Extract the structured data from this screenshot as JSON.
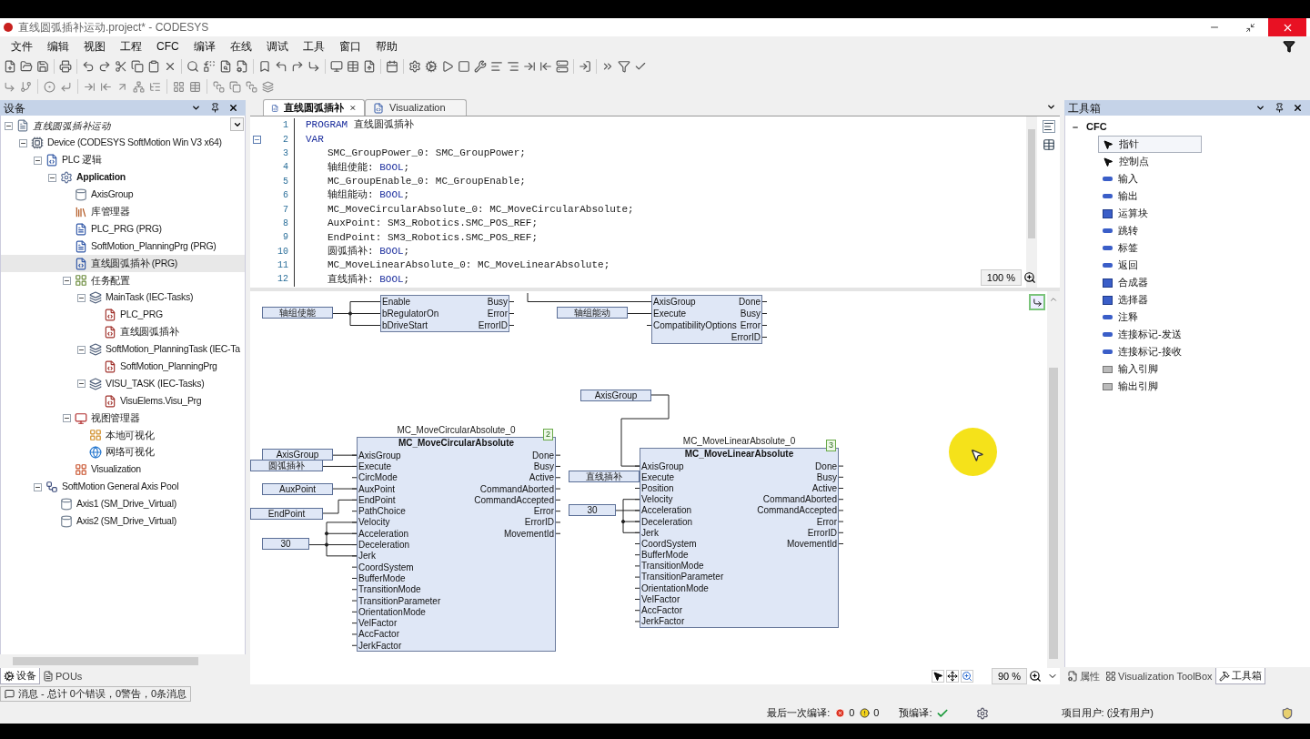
{
  "window": {
    "title": "直线圆弧插补运动.project* - CODESYS"
  },
  "menu": [
    "文件",
    "编辑",
    "视图",
    "工程",
    "CFC",
    "编译",
    "在线",
    "调试",
    "工具",
    "窗口",
    "帮助"
  ],
  "devices_panel": {
    "title": "设备",
    "tree": [
      {
        "label": "直线圆弧插补运动",
        "kind": "project",
        "expanded": true,
        "selected": false,
        "children": [
          {
            "label": "Device (CODESYS SoftMotion Win V3 x64)",
            "kind": "device",
            "expanded": true,
            "selected": false,
            "children": [
              {
                "label": "PLC 逻辑",
                "kind": "plc",
                "expanded": true,
                "selected": false,
                "children": [
                  {
                    "label": "Application",
                    "kind": "application",
                    "expanded": true,
                    "selected": false,
                    "children": [
                      {
                        "label": "AxisGroup",
                        "kind": "axisgroup",
                        "selected": false
                      },
                      {
                        "label": "库管理器",
                        "kind": "library",
                        "selected": false
                      },
                      {
                        "label": "PLC_PRG (PRG)",
                        "kind": "pou",
                        "selected": false
                      },
                      {
                        "label": "SoftMotion_PlanningPrg (PRG)",
                        "kind": "pou",
                        "selected": false
                      },
                      {
                        "label": "直线圆弧插补 (PRG)",
                        "kind": "cfc",
                        "selected": true
                      },
                      {
                        "label": "任务配置",
                        "kind": "taskconfig",
                        "expanded": true,
                        "selected": false,
                        "children": [
                          {
                            "label": "MainTask (IEC-Tasks)",
                            "kind": "task",
                            "expanded": true,
                            "selected": false,
                            "children": [
                              {
                                "label": "PLC_PRG",
                                "kind": "call",
                                "selected": false
                              },
                              {
                                "label": "直线圆弧插补",
                                "kind": "call",
                                "selected": false
                              }
                            ]
                          },
                          {
                            "label": "SoftMotion_PlanningTask (IEC-Ta",
                            "kind": "task",
                            "expanded": true,
                            "selected": false,
                            "children": [
                              {
                                "label": "SoftMotion_PlanningPrg",
                                "kind": "call",
                                "selected": false
                              }
                            ]
                          },
                          {
                            "label": "VISU_TASK (IEC-Tasks)",
                            "kind": "task",
                            "expanded": true,
                            "selected": false,
                            "children": [
                              {
                                "label": "VisuElems.Visu_Prg",
                                "kind": "call",
                                "selected": false
                              }
                            ]
                          }
                        ]
                      },
                      {
                        "label": "视图管理器",
                        "kind": "visumanager",
                        "expanded": true,
                        "selected": false,
                        "children": [
                          {
                            "label": "本地可视化",
                            "kind": "localvisu",
                            "selected": false
                          },
                          {
                            "label": "网络可视化",
                            "kind": "webvisu",
                            "selected": false
                          }
                        ]
                      },
                      {
                        "label": "Visualization",
                        "kind": "visu",
                        "selected": false
                      }
                    ]
                  }
                ]
              },
              {
                "label": "SoftMotion General Axis Pool",
                "kind": "axispool",
                "expanded": true,
                "selected": false,
                "children": [
                  {
                    "label": "Axis1 (SM_Drive_Virtual)",
                    "kind": "axis",
                    "selected": false
                  },
                  {
                    "label": "Axis2 (SM_Drive_Virtual)",
                    "kind": "axis",
                    "selected": false
                  }
                ]
              }
            ]
          }
        ]
      }
    ],
    "tabs": [
      {
        "label": "设备",
        "selected": true
      },
      {
        "label": "POUs",
        "selected": false
      }
    ]
  },
  "editor": {
    "tabs": [
      {
        "label": "直线圆弧插补",
        "selected": true
      },
      {
        "label": "Visualization",
        "selected": false
      }
    ],
    "code": {
      "zoom": "100 %",
      "lines": [
        {
          "number": "1",
          "segments": [
            {
              "kind": "keyword",
              "text": "PROGRAM"
            },
            {
              "kind": "plain",
              "text": " 直线圆弧插补"
            }
          ]
        },
        {
          "number": "2",
          "expanded": true,
          "segments": [
            {
              "kind": "keyword",
              "text": "VAR"
            }
          ],
          "children": [
            {
              "number": "3",
              "segments": [
                {
                  "kind": "plain",
                  "text": "SMC_GroupPower_0: SMC_GroupPower;"
                }
              ]
            },
            {
              "number": "4",
              "segments": [
                {
                  "kind": "plain",
                  "text": "轴组使能: "
                },
                {
                  "kind": "keyword",
                  "text": "BOOL"
                },
                {
                  "kind": "plain",
                  "text": ";"
                }
              ]
            },
            {
              "number": "5",
              "segments": [
                {
                  "kind": "plain",
                  "text": "MC_GroupEnable_0: MC_GroupEnable;"
                }
              ]
            },
            {
              "number": "6",
              "segments": [
                {
                  "kind": "plain",
                  "text": "轴组能动: "
                },
                {
                  "kind": "keyword",
                  "text": "BOOL"
                },
                {
                  "kind": "plain",
                  "text": ";"
                }
              ]
            },
            {
              "number": "7",
              "segments": [
                {
                  "kind": "plain",
                  "text": "MC_MoveCircularAbsolute_0: MC_MoveCircularAbsolute;"
                }
              ]
            },
            {
              "number": "8",
              "segments": [
                {
                  "kind": "plain",
                  "text": "AuxPoint: SM3_Robotics.SMC_POS_REF;"
                }
              ]
            },
            {
              "number": "9",
              "segments": [
                {
                  "kind": "plain",
                  "text": "EndPoint: SM3_Robotics.SMC_POS_REF;"
                }
              ]
            },
            {
              "number": "10",
              "segments": [
                {
                  "kind": "plain",
                  "text": "圆弧插补: "
                },
                {
                  "kind": "keyword",
                  "text": "BOOL"
                },
                {
                  "kind": "plain",
                  "text": ";"
                }
              ]
            },
            {
              "number": "11",
              "segments": [
                {
                  "kind": "plain",
                  "text": "MC_MoveLinearAbsolute_0: MC_MoveLinearAbsolute;"
                }
              ]
            },
            {
              "number": "12",
              "segments": [
                {
                  "kind": "plain",
                  "text": "直线插补: "
                },
                {
                  "kind": "keyword",
                  "text": "BOOL"
                },
                {
                  "kind": "plain",
                  "text": ";"
                }
              ]
            }
          ]
        }
      ]
    },
    "cfc": {
      "zoom": "90 %",
      "variables": [
        "轴组使能",
        "轴组能动",
        "AxisGroup",
        "AxisGroup",
        "圆弧插补",
        "AuxPoint",
        "EndPoint",
        "30",
        "直线插补",
        "30"
      ],
      "blocks": [
        {
          "inputs": [
            "Enable",
            "bRegulatorOn",
            "bDriveStart"
          ],
          "outputs": [
            "Busy",
            "Error",
            "ErrorID"
          ]
        },
        {
          "inputs": [
            "AxisGroup",
            "Execute",
            "CompatibilityOptions"
          ],
          "outputs": [
            "Done",
            "Busy",
            "Error",
            "ErrorID"
          ]
        },
        {
          "instance": "MC_MoveCircularAbsolute_0",
          "type": "MC_MoveCircularAbsolute",
          "order": "2",
          "inputs": [
            "AxisGroup",
            "Execute",
            "CircMode",
            "AuxPoint",
            "EndPoint",
            "PathChoice",
            "Velocity",
            "Acceleration",
            "Deceleration",
            "Jerk",
            "CoordSystem",
            "BufferMode",
            "TransitionMode",
            "TransitionParameter",
            "OrientationMode",
            "VelFactor",
            "AccFactor",
            "JerkFactor"
          ],
          "outputs": [
            "Done",
            "Busy",
            "Active",
            "CommandAborted",
            "CommandAccepted",
            "Error",
            "ErrorID",
            "MovementId"
          ]
        },
        {
          "instance": "MC_MoveLinearAbsolute_0",
          "type": "MC_MoveLinearAbsolute",
          "order": "3",
          "inputs": [
            "AxisGroup",
            "Execute",
            "Position",
            "Velocity",
            "Acceleration",
            "Deceleration",
            "Jerk",
            "CoordSystem",
            "BufferMode",
            "TransitionMode",
            "TransitionParameter",
            "OrientationMode",
            "VelFactor",
            "AccFactor",
            "JerkFactor"
          ],
          "outputs": [
            "Done",
            "Busy",
            "Active",
            "CommandAborted",
            "CommandAccepted",
            "Error",
            "ErrorID",
            "MovementId"
          ]
        }
      ]
    }
  },
  "toolbox": {
    "title": "工具箱",
    "category": "CFC",
    "expanded": true,
    "items": [
      {
        "label": "指针",
        "kind": "pointer",
        "selected": true
      },
      {
        "label": "控制点",
        "kind": "pointer",
        "selected": false
      },
      {
        "label": "输入",
        "kind": "element",
        "selected": false
      },
      {
        "label": "输出",
        "kind": "element",
        "selected": false
      },
      {
        "label": "运算块",
        "kind": "block",
        "selected": false
      },
      {
        "label": "跳转",
        "kind": "element",
        "selected": false
      },
      {
        "label": "标签",
        "kind": "element",
        "selected": false
      },
      {
        "label": "返回",
        "kind": "element",
        "selected": false
      },
      {
        "label": "合成器",
        "kind": "block",
        "selected": false
      },
      {
        "label": "选择器",
        "kind": "block",
        "selected": false
      },
      {
        "label": "注释",
        "kind": "element",
        "selected": false
      },
      {
        "label": "连接标记-发送",
        "kind": "element",
        "selected": false
      },
      {
        "label": "连接标记-接收",
        "kind": "element",
        "selected": false
      },
      {
        "label": "输入引脚",
        "kind": "pin",
        "selected": false
      },
      {
        "label": "输出引脚",
        "kind": "pin",
        "selected": false
      }
    ],
    "tabs": [
      {
        "label": "属性",
        "selected": false
      },
      {
        "label": "Visualization ToolBox",
        "selected": false
      },
      {
        "label": "工具箱",
        "selected": true
      }
    ]
  },
  "messages_tab": "消息 - 总计 0个错误，0警告，0条消息",
  "status_bar": {
    "last_build_label": "最后一次编译:",
    "errors": "0",
    "warnings": "0",
    "precompile_label": "预编译:",
    "precompile_ok": true,
    "project_user": "项目用户: (没有用户)"
  }
}
